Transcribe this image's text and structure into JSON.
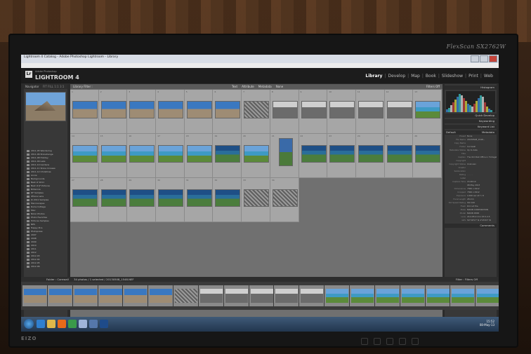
{
  "monitor": {
    "brand": "FlexScan SX2762W",
    "maker": "EIZO"
  },
  "window": {
    "title": "Lightroom 4 Catalog - Adobe Photoshop Lightroom - Library"
  },
  "menu": [
    "File",
    "Edit",
    "Library",
    "Photo",
    "Metadata",
    "View",
    "Window",
    "Help"
  ],
  "identity": {
    "logo": "Lr",
    "product": "Adobe Photoshop",
    "name": "LIGHTROOM 4"
  },
  "modules": [
    "Library",
    "Develop",
    "Map",
    "Book",
    "Slideshow",
    "Print",
    "Web"
  ],
  "active_module": "Library",
  "left_panel": {
    "navigator": "Navigator",
    "navigator_opts": "FIT  FILL  1:1  3:1",
    "folders": [
      "2011-05 Wandering",
      "2011-06 Stonehenge",
      "2011-08 Holiday",
      "2011-09 Lake",
      "2011-10 Gardens",
      "2011-11 Stone Crosses",
      "2011-12 Christmas",
      "Annie",
      "Backgrounds",
      "Best of 2011",
      "Best of JF Pictures",
      "Britannia",
      "DF Samples",
      "iPhone Lens",
      "JS 2011 Samples",
      "Macroscapes",
      "Ruins Cottage",
      "Misc",
      "Nikon Photos",
      "Photo Favorites",
      "Pictures Samples",
      "NPS",
      "Happy Pics",
      "Photopress",
      "2007",
      "2008",
      "2009",
      "2010",
      "2011",
      "2012",
      "2012-03",
      "2012-04",
      "2012-05",
      "2012-06"
    ],
    "import_label": "Import...",
    "export_label": "Export..."
  },
  "filter_bar": {
    "library": "Library Filter :",
    "options": [
      "Text",
      "Attribute",
      "Metadata",
      "None"
    ],
    "preset": "Filters Off"
  },
  "grid": {
    "cells": [
      {
        "num": "1",
        "kind": "sky"
      },
      {
        "num": "2",
        "kind": "sky"
      },
      {
        "num": "3",
        "kind": "sky"
      },
      {
        "num": "4",
        "kind": "sky"
      },
      {
        "num": "5",
        "kind": "sky"
      },
      {
        "num": "6",
        "kind": "sky"
      },
      {
        "num": "7",
        "kind": "rock"
      },
      {
        "num": "8",
        "kind": "bw"
      },
      {
        "num": "9",
        "kind": "bw"
      },
      {
        "num": "10",
        "kind": "bw"
      },
      {
        "num": "11",
        "kind": "bw"
      },
      {
        "num": "12",
        "kind": "bw"
      },
      {
        "num": "13",
        "kind": "sea"
      },
      {
        "num": "14",
        "kind": "sea"
      },
      {
        "num": "15",
        "kind": "sea"
      },
      {
        "num": "16",
        "kind": "sea"
      },
      {
        "num": "17",
        "kind": "sea"
      },
      {
        "num": "18",
        "kind": "sea"
      },
      {
        "num": "19",
        "kind": "cliff"
      },
      {
        "num": "20",
        "kind": "sea"
      },
      {
        "num": "21",
        "kind": "tall"
      },
      {
        "num": "22",
        "kind": "cliff"
      },
      {
        "num": "23",
        "kind": "cliff"
      },
      {
        "num": "24",
        "kind": "cliff"
      },
      {
        "num": "25",
        "kind": "cliff"
      },
      {
        "num": "26",
        "kind": "cliff"
      },
      {
        "num": "27",
        "kind": "cliff"
      },
      {
        "num": "28",
        "kind": "cliff"
      },
      {
        "num": "29",
        "kind": "cliff"
      },
      {
        "num": "30",
        "kind": "cliff"
      },
      {
        "num": "31",
        "kind": "cliff"
      },
      {
        "num": "32",
        "kind": "cliff"
      },
      {
        "num": "33",
        "kind": "rock"
      },
      {
        "num": "34",
        "kind": "rock"
      },
      {
        "num": "",
        "kind": "empty"
      },
      {
        "num": "",
        "kind": "empty"
      },
      {
        "num": "",
        "kind": "empty"
      },
      {
        "num": "",
        "kind": "empty"
      },
      {
        "num": "",
        "kind": "empty"
      }
    ]
  },
  "toolbar": {
    "sort_label": "Sort: File Name",
    "thumbnails": "Thumbnails"
  },
  "right_panel": {
    "histogram": "Histogram",
    "quick_develop": "Quick Develop",
    "keywording": "Keywording",
    "keyword_list": "Keyword List",
    "metadata": "Metadata",
    "metadata_preset": "Default",
    "rows": [
      {
        "k": "Preset",
        "v": "None"
      },
      {
        "k": "File Name",
        "v": "20130508_1548..."
      },
      {
        "k": "Copy Name",
        "v": ""
      },
      {
        "k": "Folder",
        "v": "Cornwall"
      },
      {
        "k": "Metadata Status",
        "v": "Up to date"
      },
      {
        "k": "Title",
        "v": ""
      },
      {
        "k": "Caption",
        "v": "The Old Post Office in Tintagel"
      },
      {
        "k": "Copyright",
        "v": ""
      },
      {
        "k": "Copyright Status",
        "v": "Unknown"
      },
      {
        "k": "Creator",
        "v": ""
      },
      {
        "k": "Sublocation",
        "v": ""
      },
      {
        "k": "Rating",
        "v": "· · · · ·"
      },
      {
        "k": "Label",
        "v": ""
      },
      {
        "k": "Capture Time",
        "v": "15:48:10"
      },
      {
        "k": "",
        "v": "08 May 2013"
      },
      {
        "k": "Dimensions",
        "v": "7360 x 4912"
      },
      {
        "k": "Cropped",
        "v": "7360 x 4912"
      },
      {
        "k": "Exposure",
        "v": "1/160 sec at f / 8"
      },
      {
        "k": "Focal Length",
        "v": "28 mm"
      },
      {
        "k": "ISO Speed Rating",
        "v": "ISO 100"
      },
      {
        "k": "Flash",
        "v": "Did not fire"
      },
      {
        "k": "Make",
        "v": "NIKON CORPORATION"
      },
      {
        "k": "Model",
        "v": "NIKON D800"
      },
      {
        "k": "Lens",
        "v": "24.0-85.0 mm f/3.5-4.5"
      },
      {
        "k": "GPS",
        "v": "50°39'57\" N 4°45'03\" W"
      }
    ],
    "comments": "Comments",
    "sync_metadata": "Sync Metadata",
    "sync_settings": "Sync Settings"
  },
  "filmstrip": {
    "source": "Folder : Cornwall",
    "count": "34 photos / 1 selected / 20130508_1548.NEF",
    "filter_label": "Filter :",
    "filter_value": "Filters Off",
    "thumbs": [
      "sky",
      "sky",
      "sky",
      "sky",
      "sky",
      "sky",
      "rock",
      "bw",
      "bw",
      "bw",
      "bw",
      "bw",
      "sea",
      "sea",
      "sea",
      "sea",
      "sea",
      "sea",
      "sea"
    ]
  },
  "taskbar": {
    "time": "15:52",
    "date": "08-May-13"
  },
  "colors": {
    "accent": "#3a78c0",
    "panel": "#383838",
    "grid_bg": "#707070"
  }
}
